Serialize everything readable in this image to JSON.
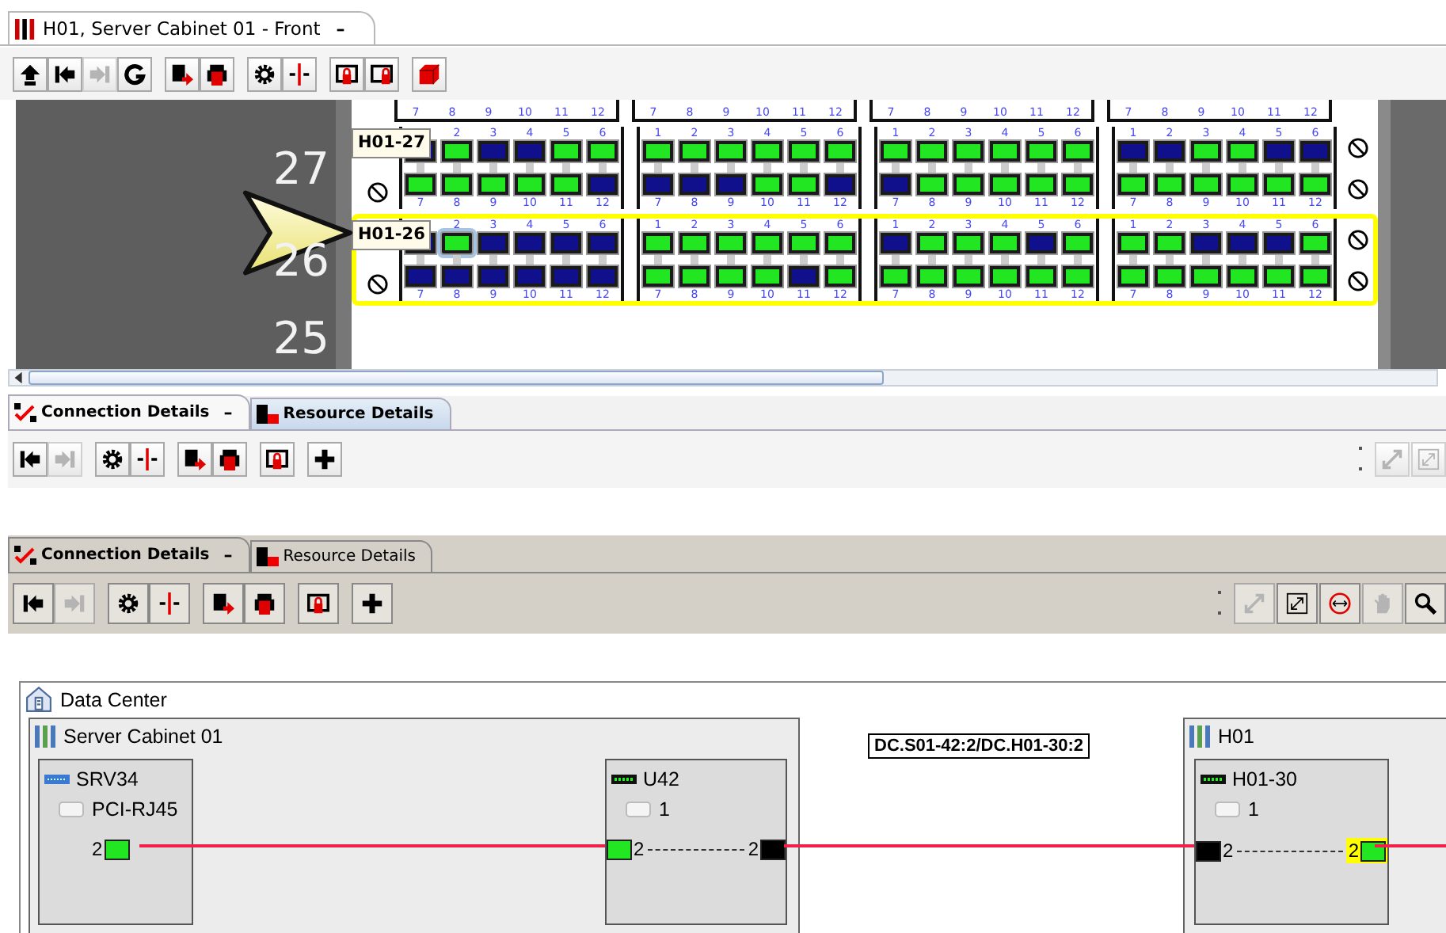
{
  "window_tab": {
    "title": "H01, Server Cabinet 01 - Front",
    "minimize": "–",
    "selected": true
  },
  "main_toolbar": {
    "groups": [
      [
        {
          "kind": "up",
          "disabled": false
        },
        {
          "kind": "back",
          "disabled": false
        },
        {
          "kind": "forward",
          "disabled": true
        },
        {
          "kind": "refresh",
          "disabled": false
        }
      ],
      [
        {
          "kind": "export",
          "disabled": false
        },
        {
          "kind": "print",
          "disabled": false
        }
      ],
      [
        {
          "kind": "gear",
          "disabled": false
        },
        {
          "kind": "split",
          "disabled": false
        }
      ],
      [
        {
          "kind": "lockin",
          "disabled": false
        },
        {
          "kind": "lockout",
          "disabled": false
        }
      ],
      [
        {
          "kind": "cube",
          "disabled": false
        }
      ]
    ]
  },
  "rack": {
    "partial_unit": {
      "panels": [
        {
          "labels": [
            "7",
            "8",
            "9",
            "10",
            "11",
            "12"
          ]
        },
        {
          "labels": [
            "7",
            "8",
            "9",
            "10",
            "11",
            "12"
          ]
        },
        {
          "labels": [
            "7",
            "8",
            "9",
            "10",
            "11",
            "12"
          ]
        },
        {
          "labels": [
            "7",
            "8",
            "9",
            "10",
            "11",
            "12"
          ]
        }
      ]
    },
    "units": [
      {
        "number": "27",
        "tag": "H01-27",
        "selected": false,
        "panels": [
          {
            "ports": [
              {
                "color": "#10108c",
                "selected": false
              },
              {
                "label": "2",
                "color": "#22e622",
                "selected": false
              },
              {
                "label": "3",
                "color": "#10108c",
                "selected": false
              },
              {
                "label": "4",
                "color": "#10108c",
                "selected": false
              },
              {
                "label": "5",
                "color": "#22e622",
                "selected": false
              },
              {
                "label": "6",
                "color": "#22e622",
                "selected": false
              },
              {
                "label": "7",
                "color": "#22e622",
                "selected": false
              },
              {
                "label": "8",
                "color": "#22e622",
                "selected": false
              },
              {
                "label": "9",
                "color": "#22e622",
                "selected": false
              },
              {
                "label": "10",
                "color": "#22e622",
                "selected": false
              },
              {
                "label": "11",
                "color": "#22e622",
                "selected": false
              },
              {
                "label": "12",
                "color": "#10108c",
                "selected": false
              }
            ]
          },
          {
            "ports": [
              {
                "label": "1",
                "color": "#22e622",
                "selected": false
              },
              {
                "label": "2",
                "color": "#22e622",
                "selected": false
              },
              {
                "label": "3",
                "color": "#22e622",
                "selected": false
              },
              {
                "label": "4",
                "color": "#22e622",
                "selected": false
              },
              {
                "label": "5",
                "color": "#22e622",
                "selected": false
              },
              {
                "label": "6",
                "color": "#22e622",
                "selected": false
              },
              {
                "label": "7",
                "color": "#10108c",
                "selected": false
              },
              {
                "label": "8",
                "color": "#10108c",
                "selected": false
              },
              {
                "label": "9",
                "color": "#10108c",
                "selected": false
              },
              {
                "label": "10",
                "color": "#22e622",
                "selected": false
              },
              {
                "label": "11",
                "color": "#22e622",
                "selected": false
              },
              {
                "label": "12",
                "color": "#10108c",
                "selected": false
              }
            ]
          },
          {
            "ports": [
              {
                "label": "1",
                "color": "#22e622",
                "selected": false
              },
              {
                "label": "2",
                "color": "#22e622",
                "selected": false
              },
              {
                "label": "3",
                "color": "#22e622",
                "selected": false
              },
              {
                "label": "4",
                "color": "#22e622",
                "selected": false
              },
              {
                "label": "5",
                "color": "#22e622",
                "selected": false
              },
              {
                "label": "6",
                "color": "#22e622",
                "selected": false
              },
              {
                "label": "7",
                "color": "#10108c",
                "selected": false
              },
              {
                "label": "8",
                "color": "#22e622",
                "selected": false
              },
              {
                "label": "9",
                "color": "#22e622",
                "selected": false
              },
              {
                "label": "10",
                "color": "#22e622",
                "selected": false
              },
              {
                "label": "11",
                "color": "#22e622",
                "selected": false
              },
              {
                "label": "12",
                "color": "#22e622",
                "selected": false
              }
            ]
          },
          {
            "ports": [
              {
                "label": "1",
                "color": "#10108c",
                "selected": false
              },
              {
                "label": "2",
                "color": "#10108c",
                "selected": false
              },
              {
                "label": "3",
                "color": "#22e622",
                "selected": false
              },
              {
                "label": "4",
                "color": "#22e622",
                "selected": false
              },
              {
                "label": "5",
                "color": "#10108c",
                "selected": false
              },
              {
                "label": "6",
                "color": "#10108c",
                "selected": false
              },
              {
                "label": "7",
                "color": "#22e622",
                "selected": false
              },
              {
                "label": "8",
                "color": "#22e622",
                "selected": false
              },
              {
                "label": "9",
                "color": "#22e622",
                "selected": false
              },
              {
                "label": "10",
                "color": "#22e622",
                "selected": false
              },
              {
                "label": "11",
                "color": "#22e622",
                "selected": false
              },
              {
                "label": "12",
                "color": "#22e622",
                "selected": false
              }
            ]
          }
        ]
      },
      {
        "number": "26",
        "tag": "H01-26",
        "selected": true,
        "panels": [
          {
            "ports": [
              {
                "color": "#10108c",
                "selected": false
              },
              {
                "label": "2",
                "color": "#22e622",
                "selected": true
              },
              {
                "label": "3",
                "color": "#10108c",
                "selected": false
              },
              {
                "label": "4",
                "color": "#10108c",
                "selected": false
              },
              {
                "label": "5",
                "color": "#10108c",
                "selected": false
              },
              {
                "label": "6",
                "color": "#10108c",
                "selected": false
              },
              {
                "label": "7",
                "color": "#10108c",
                "selected": false
              },
              {
                "label": "8",
                "color": "#10108c",
                "selected": false
              },
              {
                "label": "9",
                "color": "#10108c",
                "selected": false
              },
              {
                "label": "10",
                "color": "#10108c",
                "selected": false
              },
              {
                "label": "11",
                "color": "#10108c",
                "selected": false
              },
              {
                "label": "12",
                "color": "#10108c",
                "selected": false
              }
            ]
          },
          {
            "ports": [
              {
                "label": "1",
                "color": "#22e622",
                "selected": false
              },
              {
                "label": "2",
                "color": "#22e622",
                "selected": false
              },
              {
                "label": "3",
                "color": "#22e622",
                "selected": false
              },
              {
                "label": "4",
                "color": "#22e622",
                "selected": false
              },
              {
                "label": "5",
                "color": "#22e622",
                "selected": false
              },
              {
                "label": "6",
                "color": "#22e622",
                "selected": false
              },
              {
                "label": "7",
                "color": "#22e622",
                "selected": false
              },
              {
                "label": "8",
                "color": "#22e622",
                "selected": false
              },
              {
                "label": "9",
                "color": "#22e622",
                "selected": false
              },
              {
                "label": "10",
                "color": "#22e622",
                "selected": false
              },
              {
                "label": "11",
                "color": "#10108c",
                "selected": false
              },
              {
                "label": "12",
                "color": "#22e622",
                "selected": false
              }
            ]
          },
          {
            "ports": [
              {
                "label": "1",
                "color": "#10108c",
                "selected": false
              },
              {
                "label": "2",
                "color": "#22e622",
                "selected": false
              },
              {
                "label": "3",
                "color": "#22e622",
                "selected": false
              },
              {
                "label": "4",
                "color": "#22e622",
                "selected": false
              },
              {
                "label": "5",
                "color": "#10108c",
                "selected": false
              },
              {
                "label": "6",
                "color": "#22e622",
                "selected": false
              },
              {
                "label": "7",
                "color": "#22e622",
                "selected": false
              },
              {
                "label": "8",
                "color": "#22e622",
                "selected": false
              },
              {
                "label": "9",
                "color": "#22e622",
                "selected": false
              },
              {
                "label": "10",
                "color": "#22e622",
                "selected": false
              },
              {
                "label": "11",
                "color": "#22e622",
                "selected": false
              },
              {
                "label": "12",
                "color": "#22e622",
                "selected": false
              }
            ]
          },
          {
            "ports": [
              {
                "label": "1",
                "color": "#22e622",
                "selected": false
              },
              {
                "label": "2",
                "color": "#22e622",
                "selected": false
              },
              {
                "label": "3",
                "color": "#10108c",
                "selected": false
              },
              {
                "label": "4",
                "color": "#10108c",
                "selected": false
              },
              {
                "label": "5",
                "color": "#10108c",
                "selected": false
              },
              {
                "label": "6",
                "color": "#22e622",
                "selected": false
              },
              {
                "label": "7",
                "color": "#22e622",
                "selected": false
              },
              {
                "label": "8",
                "color": "#22e622",
                "selected": false
              },
              {
                "label": "9",
                "color": "#22e622",
                "selected": false
              },
              {
                "label": "10",
                "color": "#22e622",
                "selected": false
              },
              {
                "label": "11",
                "color": "#22e622",
                "selected": false
              },
              {
                "label": "12",
                "color": "#22e622",
                "selected": false
              }
            ]
          }
        ]
      },
      {
        "number": "25"
      }
    ]
  },
  "detail_panels": [
    {
      "tabs": [
        {
          "label": "Connection Details",
          "kind": "connection",
          "selected": true,
          "minimize": "–"
        },
        {
          "label": "Resource Details",
          "kind": "resource",
          "selected": false
        }
      ],
      "toolbar": {
        "groups": [
          [
            {
              "kind": "back",
              "disabled": false
            },
            {
              "kind": "forward",
              "disabled": true
            }
          ],
          [
            {
              "kind": "gear",
              "disabled": false
            },
            {
              "kind": "split",
              "disabled": false
            }
          ],
          [
            {
              "kind": "export",
              "disabled": false
            },
            {
              "kind": "print",
              "disabled": false
            }
          ],
          [
            {
              "kind": "lockin",
              "disabled": false
            }
          ],
          [
            {
              "kind": "plus",
              "disabled": false
            }
          ]
        ],
        "right": [
          {
            "kind": "expand",
            "disabled": true
          },
          {
            "kind": "fit",
            "disabled": true
          }
        ]
      }
    },
    {
      "tabs": [
        {
          "label": "Connection Details",
          "kind": "connection",
          "selected": true,
          "minimize": "–"
        },
        {
          "label": "Resource Details",
          "kind": "resource",
          "selected": false
        }
      ],
      "toolbar": {
        "groups": [
          [
            {
              "kind": "back",
              "disabled": false
            },
            {
              "kind": "forward",
              "disabled": true
            }
          ],
          [
            {
              "kind": "gear",
              "disabled": false
            },
            {
              "kind": "split",
              "disabled": false
            }
          ],
          [
            {
              "kind": "export",
              "disabled": false
            },
            {
              "kind": "print",
              "disabled": false
            }
          ],
          [
            {
              "kind": "lockin",
              "disabled": false
            }
          ],
          [
            {
              "kind": "plus",
              "disabled": false
            }
          ]
        ],
        "right": [
          {
            "kind": "expand",
            "disabled": true
          },
          {
            "kind": "fit",
            "disabled": false
          },
          {
            "kind": "link",
            "disabled": false
          },
          {
            "kind": "hand",
            "disabled": true
          },
          {
            "kind": "zoom",
            "disabled": false
          }
        ]
      }
    }
  ],
  "diagram": {
    "title": "Data Center",
    "link_label": "DC.S01-42:2/DC.H01-30:2",
    "groups": [
      {
        "title": "Server Cabinet 01",
        "devices": [
          {
            "name": "SRV34",
            "kind": "server",
            "sub": "PCI-RJ45",
            "ports": [
              {
                "label": "2",
                "color": "#22e622",
                "selected": false
              }
            ]
          },
          {
            "name": "U42",
            "kind": "panel",
            "sub": "1",
            "ports": [
              {
                "label": "2",
                "color": "#22e622",
                "selected": false
              },
              {
                "label": "2",
                "color": "#000000",
                "selected": false
              }
            ]
          }
        ]
      },
      {
        "title": "H01",
        "devices": [
          {
            "name": "H01-30",
            "kind": "panel",
            "sub": "1",
            "ports": [
              {
                "label": "2",
                "color": "#000000",
                "selected": false
              },
              {
                "label": "2",
                "color": "#22e622",
                "selected": true
              }
            ]
          }
        ]
      }
    ]
  }
}
